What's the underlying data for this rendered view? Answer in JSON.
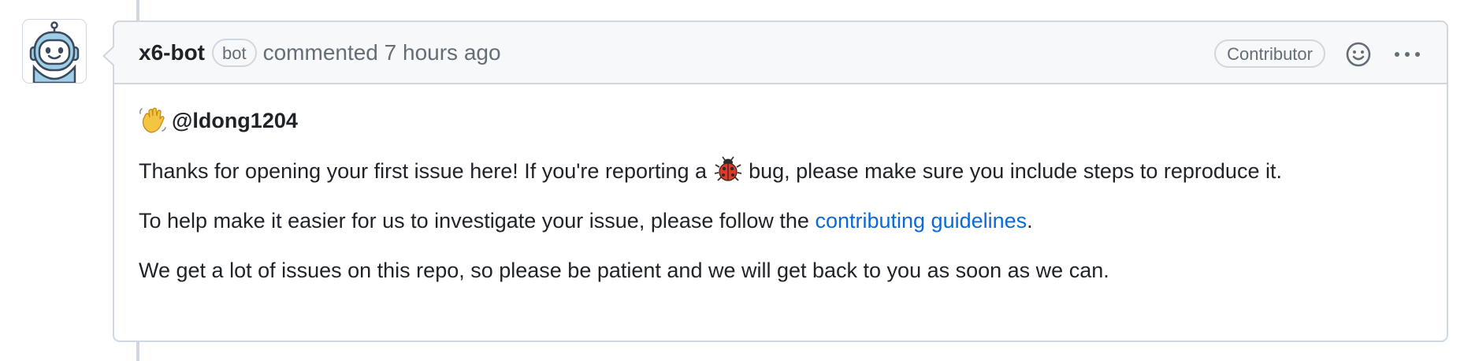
{
  "comment": {
    "author": "x6-bot",
    "bot_label": "bot",
    "action_text": "commented 7 hours ago",
    "role_badge": "Contributor",
    "greeting_mention": "@ldong1204",
    "paragraph_1_before": "Thanks for opening your first issue here! If you're reporting a",
    "paragraph_1_after": "bug, please make sure you include steps to reproduce it.",
    "paragraph_2_before": "To help make it easier for us to investigate your issue, please follow the",
    "paragraph_2_link": "contributing guidelines",
    "paragraph_2_after": ".",
    "paragraph_3": "We get a lot of issues on this repo, so please be patient and we will get back to you as soon as we can."
  },
  "icons": {
    "avatar": "robot-avatar-icon",
    "reaction": "smiley-icon",
    "more": "kebab-horizontal-icon",
    "greeting": "waving-hand-icon",
    "bug": "lady-beetle-icon"
  },
  "colors": {
    "link": "#0969da",
    "border": "#d0d7de",
    "header_bg": "#f6f8fa",
    "muted_text": "#656d76"
  }
}
